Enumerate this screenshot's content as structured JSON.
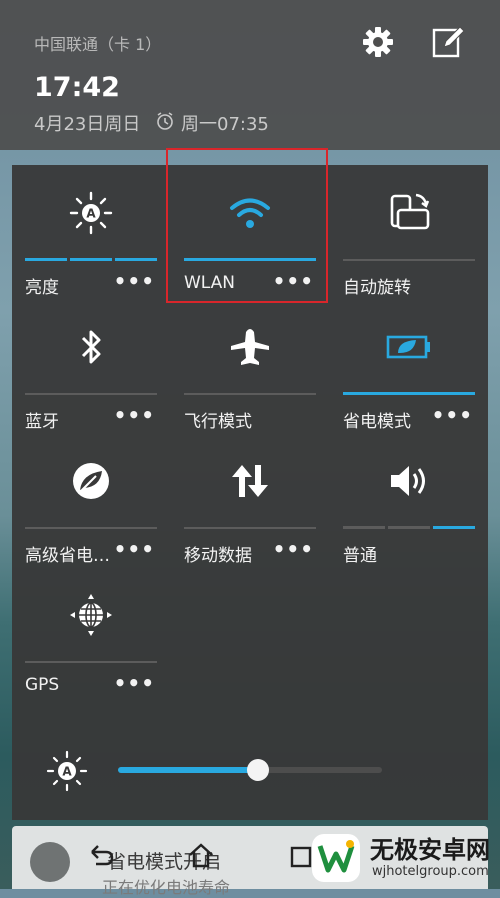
{
  "header": {
    "carrier": "中国联通（卡 1）",
    "time": "17:42",
    "date": "4月23日周日",
    "alarm": "周一07:35"
  },
  "tiles": [
    {
      "label": "亮度",
      "more": "•••",
      "icon": "auto-brightness-icon"
    },
    {
      "label": "WLAN",
      "more": "•••",
      "icon": "wifi-icon",
      "active": true
    },
    {
      "label": "自动旋转",
      "icon": "auto-rotate-icon"
    },
    {
      "label": "蓝牙",
      "more": "•••",
      "icon": "bluetooth-icon"
    },
    {
      "label": "飞行模式",
      "icon": "airplane-icon"
    },
    {
      "label": "省电模式",
      "more": "•••",
      "icon": "battery-saver-icon",
      "active": true
    },
    {
      "label": "高级省电…",
      "more": "•••",
      "icon": "eco-leaf-icon"
    },
    {
      "label": "移动数据",
      "more": "•••",
      "icon": "mobile-data-icon"
    },
    {
      "label": "普通",
      "icon": "sound-icon"
    },
    {
      "label": "GPS",
      "more": "•••",
      "icon": "gps-icon"
    }
  ],
  "brightness": {
    "value": 0.53
  },
  "notification": {
    "title": "省电模式开启",
    "subtitle": "正在优化电池寿命"
  },
  "watermark": {
    "title": "无极安卓网",
    "url": "wjhotelgroup.com"
  },
  "colors": {
    "accent": "#29a9e0",
    "highlight": "#d9262b"
  }
}
